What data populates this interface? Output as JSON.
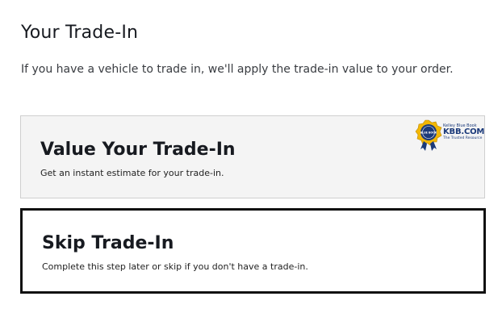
{
  "header": {
    "title": "Your Trade-In",
    "description": "If you have a vehicle to trade in, we'll apply the trade-in value to your order."
  },
  "options": [
    {
      "title": "Value Your Trade-In",
      "subtitle": "Get an instant estimate for your trade-in.",
      "selected": false,
      "partner_logo": {
        "badge_text": "BLUE BOOK",
        "line1": "Kelley Blue Book",
        "line2": "KBB.COM",
        "line3": "The Trusted Resource"
      }
    },
    {
      "title": "Skip Trade-In",
      "subtitle": "Complete this step later or skip if you don't have a trade-in.",
      "selected": true
    }
  ],
  "colors": {
    "selected_border": "#111111",
    "option_background": "#f4f4f4",
    "kbb_blue": "#1b3a7a",
    "kbb_gold": "#f2b705"
  }
}
